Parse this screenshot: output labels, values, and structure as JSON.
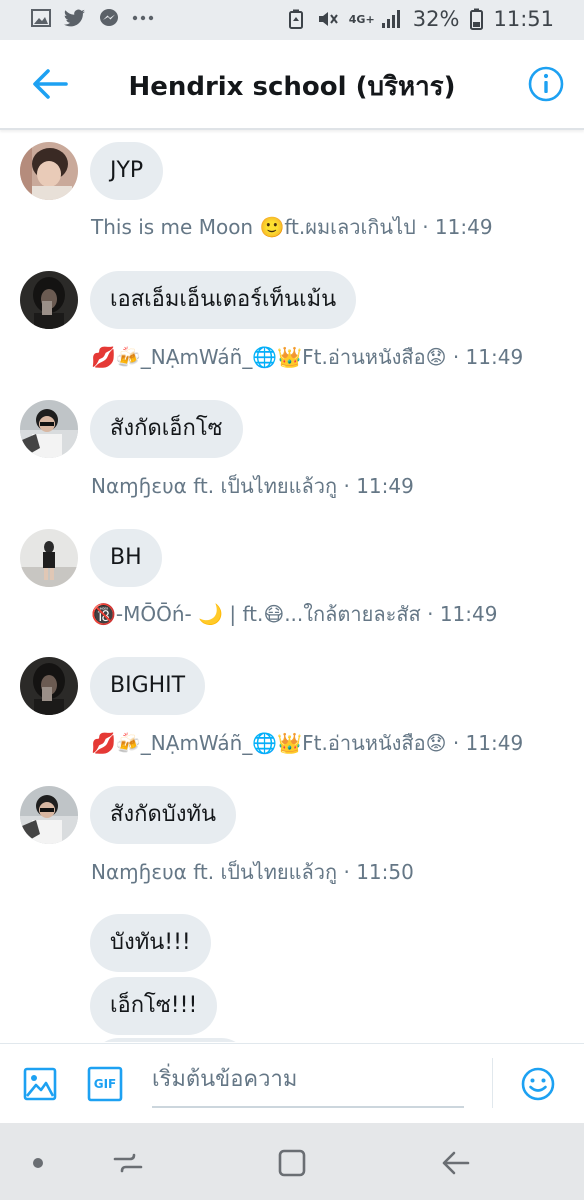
{
  "status_bar": {
    "battery": "32%",
    "time": "11:51",
    "network": "4G+",
    "left_icons": [
      "gallery-icon",
      "twitter-icon",
      "messenger-icon",
      "more-icon"
    ],
    "right_icons": [
      "battery-saver-icon",
      "mute-icon",
      "signal-icon",
      "battery-icon"
    ]
  },
  "header": {
    "title": "Hendrix school (บริหาร)",
    "back_icon": "arrow-left-icon",
    "info_icon": "info-icon"
  },
  "messages": [
    {
      "text": "JYP",
      "meta": "This is me Moon 🙂ft.ผมเลวเกินไป · 11:49",
      "avatar": "avatar-moon"
    },
    {
      "text": "เอสเอ็มเอ็นเตอร์เท็นเม้น",
      "meta": "💋🍻_NẠmWáñ_🌐👑Ft.อ่านหนังสือ😟 · 11:49",
      "avatar": "avatar-namwan"
    },
    {
      "text": "สังกัดเอ็กโซ",
      "meta": "Nαɱɧɛυα    ft. เป็นไทยแล้วกู · 11:49",
      "avatar": "avatar-namhaeua"
    },
    {
      "text": "BH",
      "meta": "🔞-MŌŌń- 🌙 | ft.😷...ใกล้ตายละสัส · 11:49",
      "avatar": "avatar-moon2"
    },
    {
      "text": "BIGHIT",
      "meta": "💋🍻_NẠmWáñ_🌐👑Ft.อ่านหนังสือ😟 · 11:49",
      "avatar": "avatar-namwan"
    },
    {
      "text": "สังกัดบังทัน",
      "meta": "Nαɱɧɛυα    ft. เป็นไทยแล้วกู · 11:50",
      "avatar": "avatar-namhaeua"
    },
    {
      "text": "บังทัน!!!",
      "meta": "",
      "avatar": ""
    },
    {
      "text": "เอ็กโซ!!!",
      "meta": "",
      "avatar": ""
    }
  ],
  "composer": {
    "placeholder": "เริ่มต้นข้อความ",
    "image_icon": "image-icon",
    "gif_label": "GIF",
    "emoji_icon": "emoji-icon"
  },
  "nav_bar": {
    "icons": [
      "dot-icon",
      "recent-apps-icon",
      "home-icon",
      "back-icon"
    ]
  },
  "colors": {
    "accent": "#1da1f2",
    "bubble": "#e7ecf0",
    "meta_text": "#657786"
  }
}
